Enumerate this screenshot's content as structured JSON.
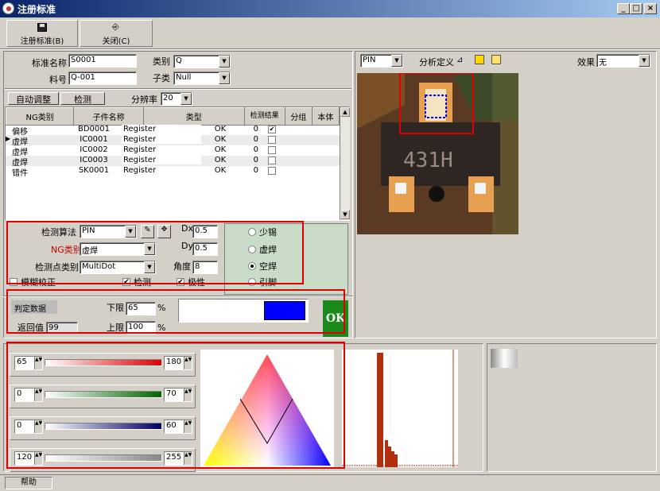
{
  "window": {
    "title": "注册标准",
    "min": "_",
    "max": "□",
    "close": "×"
  },
  "toolbar": {
    "register_label": "注册标准(B)",
    "close_label": "关闭(C)"
  },
  "form": {
    "std_name_label": "标准名称",
    "std_name_value": "S0001",
    "type_label": "类别",
    "type_value": "Q",
    "part_no_label": "料号",
    "part_no_value": "Q-001",
    "subtype_label": "子类",
    "subtype_value": "Null"
  },
  "tabs": {
    "auto_adjust": "自动调整",
    "detect": "检测",
    "resolution_label": "分辨率",
    "resolution_value": "20"
  },
  "table": {
    "headers": [
      "NG类别",
      "子件名称",
      "类型",
      "检测结果",
      "分组",
      "本体"
    ],
    "rows": [
      {
        "ng": "偏移",
        "part": "BD0001",
        "type": "Register",
        "result": "OK",
        "group": "0",
        "body": "✔"
      },
      {
        "ng": "虚焊",
        "part": "IC0001",
        "type": "Register",
        "result": "OK",
        "group": "0",
        "body": ""
      },
      {
        "ng": "虚焊",
        "part": "IC0002",
        "type": "Register",
        "result": "OK",
        "group": "0",
        "body": ""
      },
      {
        "ng": "虚焊",
        "part": "IC0003",
        "type": "Register",
        "result": "OK",
        "group": "0",
        "body": ""
      },
      {
        "ng": "错件",
        "part": "SK0001",
        "type": "Register",
        "result": "OK",
        "group": "0",
        "body": ""
      }
    ]
  },
  "detect": {
    "algo_label": "检测算法",
    "algo_value": "PIN",
    "ng_label": "NG类别",
    "ng_value": "虚焊",
    "point_label": "检测点类别",
    "point_value": "MultiDot",
    "dx_label": "Dx",
    "dx_value": "0.5",
    "dy_label": "Dy",
    "dy_value": "0.5",
    "angle_label": "角度",
    "angle_value": "8",
    "radios": [
      "少锡",
      "虚焊",
      "空焊",
      "引脚"
    ],
    "radio_selected": 2,
    "check_blur": "模糊校正",
    "check_detect": "检测",
    "check_polarity": "极性"
  },
  "judge": {
    "data_label": "判定数据",
    "lower_label": "下限",
    "lower_value": "65",
    "pct": "%",
    "return_label": "返回值",
    "return_value": "99",
    "upper_label": "上限",
    "upper_value": "100",
    "ok_label": "OK",
    "swatch_color": "#0000ff"
  },
  "view": {
    "mode_value": "PIN",
    "analysis_label": "分析定义",
    "effect_label": "效果",
    "effect_value": "无",
    "chip_text": "431H"
  },
  "color_ranges": [
    {
      "min": "65",
      "max": "180",
      "color": "#dd0000"
    },
    {
      "min": "0",
      "max": "70",
      "color": "#006600"
    },
    {
      "min": "0",
      "max": "60",
      "color": "#000066"
    },
    {
      "min": "120",
      "max": "255",
      "color": "#888888"
    }
  ],
  "status": {
    "help": "帮助"
  }
}
